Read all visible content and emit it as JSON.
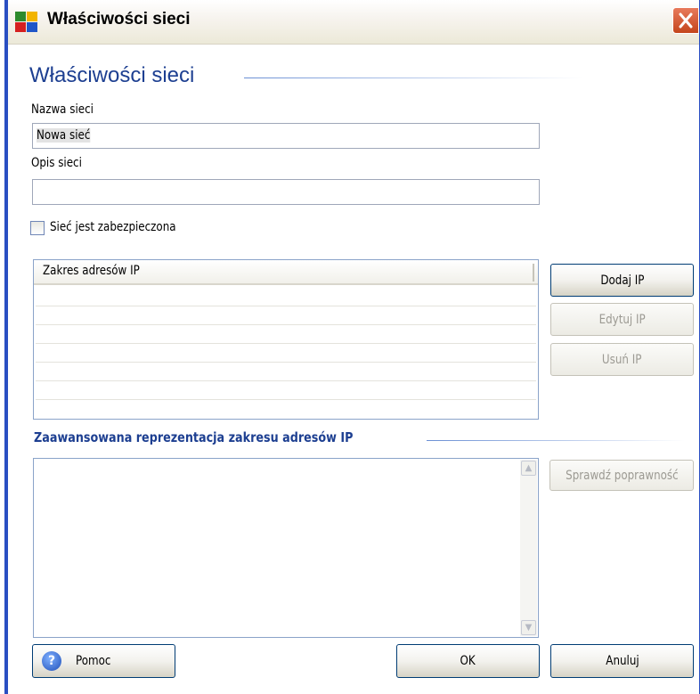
{
  "window": {
    "title": "Właściwości sieci"
  },
  "heading": "Właściwości sieci",
  "form": {
    "network_name_label": "Nazwa sieci",
    "network_name_value": "Nowa sieć",
    "network_desc_label": "Opis sieci",
    "network_desc_value": "",
    "secured_checkbox_label": "Sieć jest zabezpieczona",
    "secured_checked": false
  },
  "ip_list": {
    "column_header": "Zakres adresów IP",
    "rows": []
  },
  "ip_buttons": {
    "add": "Dodaj IP",
    "edit": "Edytuj IP",
    "remove": "Usuń IP"
  },
  "advanced": {
    "title": "Zaawansowana reprezentacja zakresu adresów IP",
    "value": "",
    "validate_button": "Sprawdź poprawność"
  },
  "footer": {
    "help": "Pomoc",
    "ok": "OK",
    "cancel": "Anuluj"
  },
  "colors": {
    "accent": "#1d3f91",
    "window_frame": "#2a4fc2",
    "close_button": "#c4451c"
  },
  "icons": {
    "app": "avg-app-icon",
    "close": "close-icon",
    "help": "help-icon",
    "scroll_up": "scroll-up-icon",
    "scroll_down": "scroll-down-icon"
  }
}
